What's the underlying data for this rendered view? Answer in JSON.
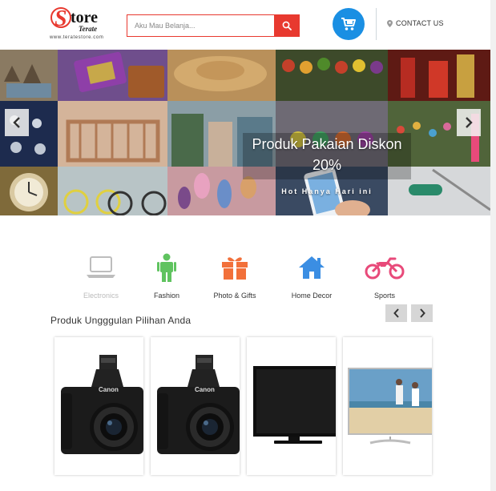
{
  "header": {
    "logo_word": "tore",
    "logo_sub": "Terate",
    "logo_url": "www.teratestore.com",
    "search_placeholder": "Aku Mau Belanja...",
    "contact_label": "CONTACT US",
    "accent_color": "#e8392f",
    "cart_color": "#1a8fe3"
  },
  "slider": {
    "title_line1": "Produk Pakaian Diskon",
    "title_line2": "20%",
    "subtitle": "Hot Hanya Hari ini"
  },
  "categories": [
    {
      "label": "Electronics",
      "icon": "laptop-icon",
      "color": "#bdbdbd",
      "active": false
    },
    {
      "label": "Fashion",
      "icon": "person-icon",
      "color": "#5fc35f"
    },
    {
      "label": "Photo & Gifts",
      "icon": "gift-icon",
      "color": "#f2703a"
    },
    {
      "label": "Home Decor",
      "icon": "home-icon",
      "color": "#3b8ee3"
    },
    {
      "label": "Sports",
      "icon": "motorcycle-icon",
      "color": "#e84a7a"
    }
  ],
  "featured": {
    "title": "Produk Ungggulan Pilihan Anda",
    "products": [
      {
        "name": "camera",
        "brand": "Canon"
      },
      {
        "name": "camera",
        "brand": "Canon"
      },
      {
        "name": "tv"
      },
      {
        "name": "tv-beach"
      }
    ]
  }
}
